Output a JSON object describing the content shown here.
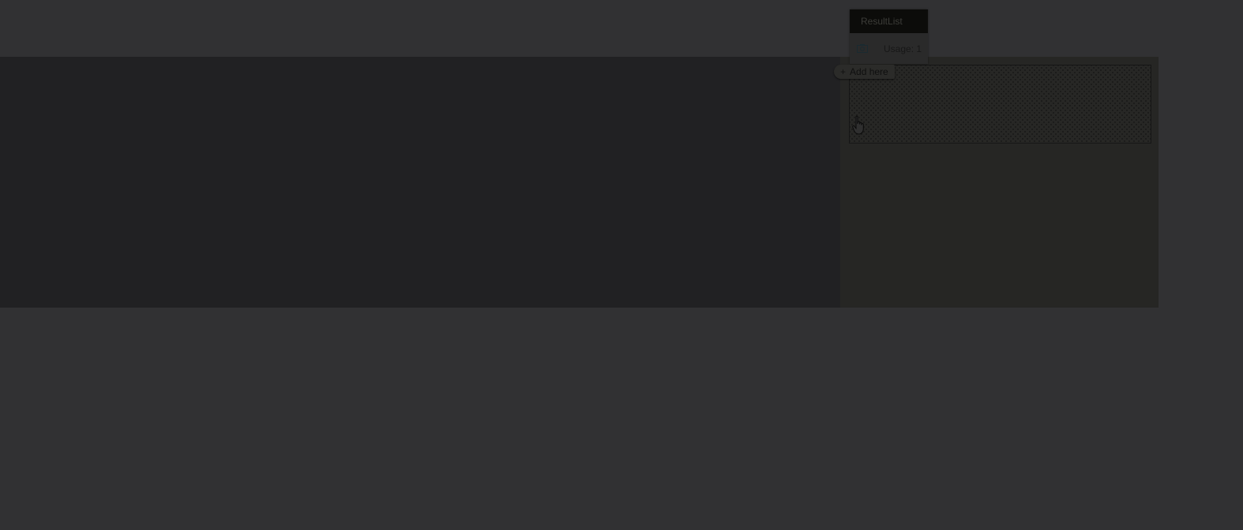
{
  "component": {
    "title": "ResultList",
    "usage_label": "Usage: 1",
    "icon": "screenshot-icon"
  },
  "drop_target": {
    "label": "Add here",
    "icon": "plus-icon"
  },
  "cursor": {
    "icon": "hand-pointer-icon"
  },
  "colors": {
    "page_background": "#313133",
    "main_area": "#212123",
    "side_area": "#262624",
    "card_header": "#0c0c0a"
  }
}
